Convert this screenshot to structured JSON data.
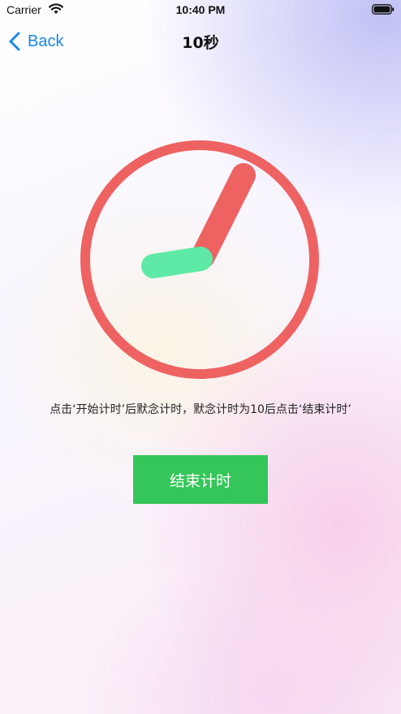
{
  "status_bar": {
    "carrier": "Carrier",
    "time": "10:40 PM",
    "wifi_icon": "wifi-icon",
    "battery_icon": "battery-icon"
  },
  "nav": {
    "back_label": "Back",
    "back_icon": "chevron-left-icon",
    "title": "10秒"
  },
  "timer_graphic": {
    "icon": "clock-icon",
    "ring_color": "#ee6262",
    "minute_hand_color": "#ee6262",
    "hour_hand_color": "#5eeaa6"
  },
  "instruction": "点击‘开始计时’后默念计时，默念计时为10后点击‘结束计时’",
  "end_button": {
    "label": "结束计时",
    "color": "#35c659"
  },
  "colors": {
    "accent": "#1a86e8"
  }
}
